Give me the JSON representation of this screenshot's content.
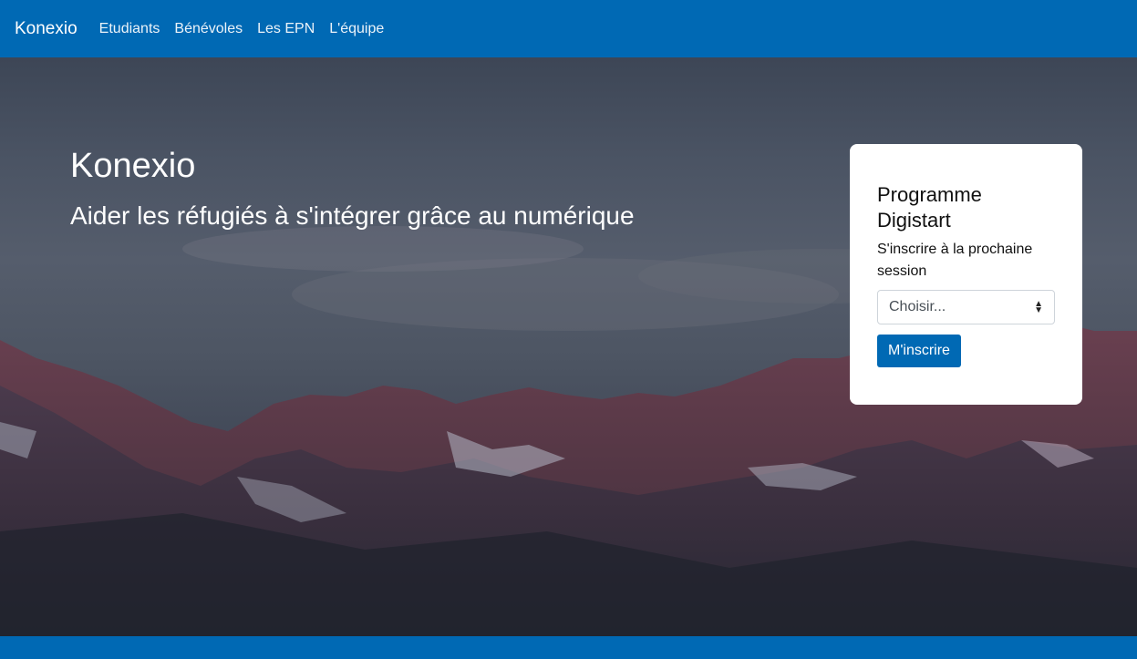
{
  "navbar": {
    "brand": "Konexio",
    "links": [
      "Etudiants",
      "Bénévoles",
      "Les EPN",
      "L'équipe"
    ]
  },
  "hero": {
    "title": "Konexio",
    "subtitle": "Aider les réfugiés à s'intégrer grâce au numérique",
    "background": "mountain-landscape-image"
  },
  "signup_card": {
    "title": "Programme Digistart",
    "text": "S'inscrire à la prochaine session",
    "select": {
      "selected": "Choisir..."
    },
    "button_label": "M'inscrire"
  },
  "colors": {
    "primary": "#0069b4",
    "card_bg": "#ffffff"
  }
}
